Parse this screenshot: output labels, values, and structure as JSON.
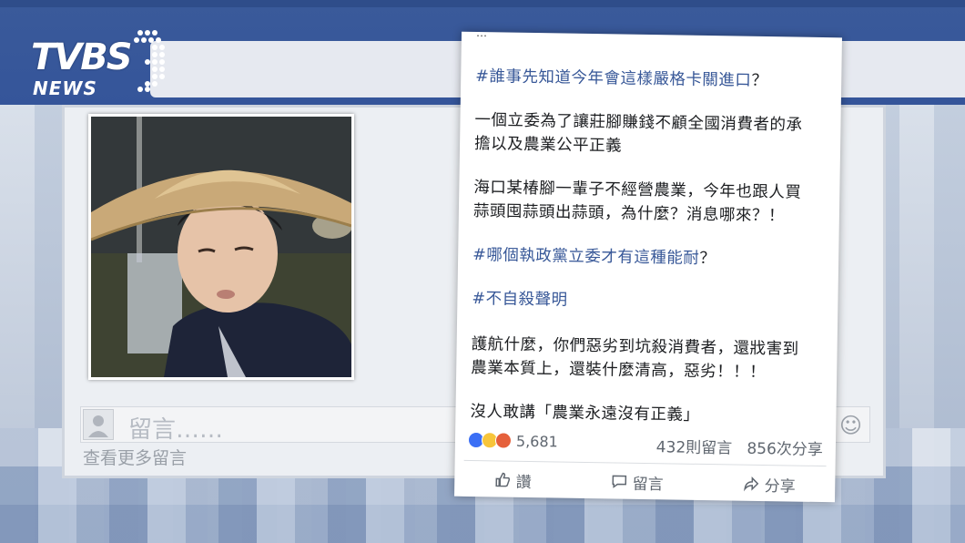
{
  "logo": {
    "brand": "TVBS",
    "subbrand": "NEWS"
  },
  "comment_box": {
    "placeholder": "留言……",
    "more_comments": "查看更多留言"
  },
  "post": {
    "cut_top": "…",
    "lines": [
      {
        "hash": "#誰事先知道今年會這樣嚴格卡關進口",
        "text": "？"
      },
      {
        "text": "一個立委為了讓莊腳賺錢不顧全國消費者的承"
      },
      {
        "text": "擔以及農業公平正義"
      },
      {
        "text": "海口某椿腳一輩子不經營農業，今年也跟人買"
      },
      {
        "text": "蒜頭囤蒜頭出蒜頭，為什麼？消息哪來？！"
      },
      {
        "hash": "#哪個執政黨立委才有這種能耐",
        "text": "？"
      },
      {
        "hash": "#不自殺聲明",
        "text": ""
      },
      {
        "text": "護航什麼，你們惡劣到坑殺消費者，還戕害到"
      },
      {
        "text": "農業本質上，還裝什麼清高，惡劣！！！"
      },
      {
        "text": "沒人敢講「農業永遠沒有正義」"
      }
    ],
    "reactions_count": "5,681",
    "comments_count": "432則留言",
    "shares_count": "856次分享",
    "actions": {
      "like": "讚",
      "comment": "留言",
      "share": "分享"
    }
  }
}
